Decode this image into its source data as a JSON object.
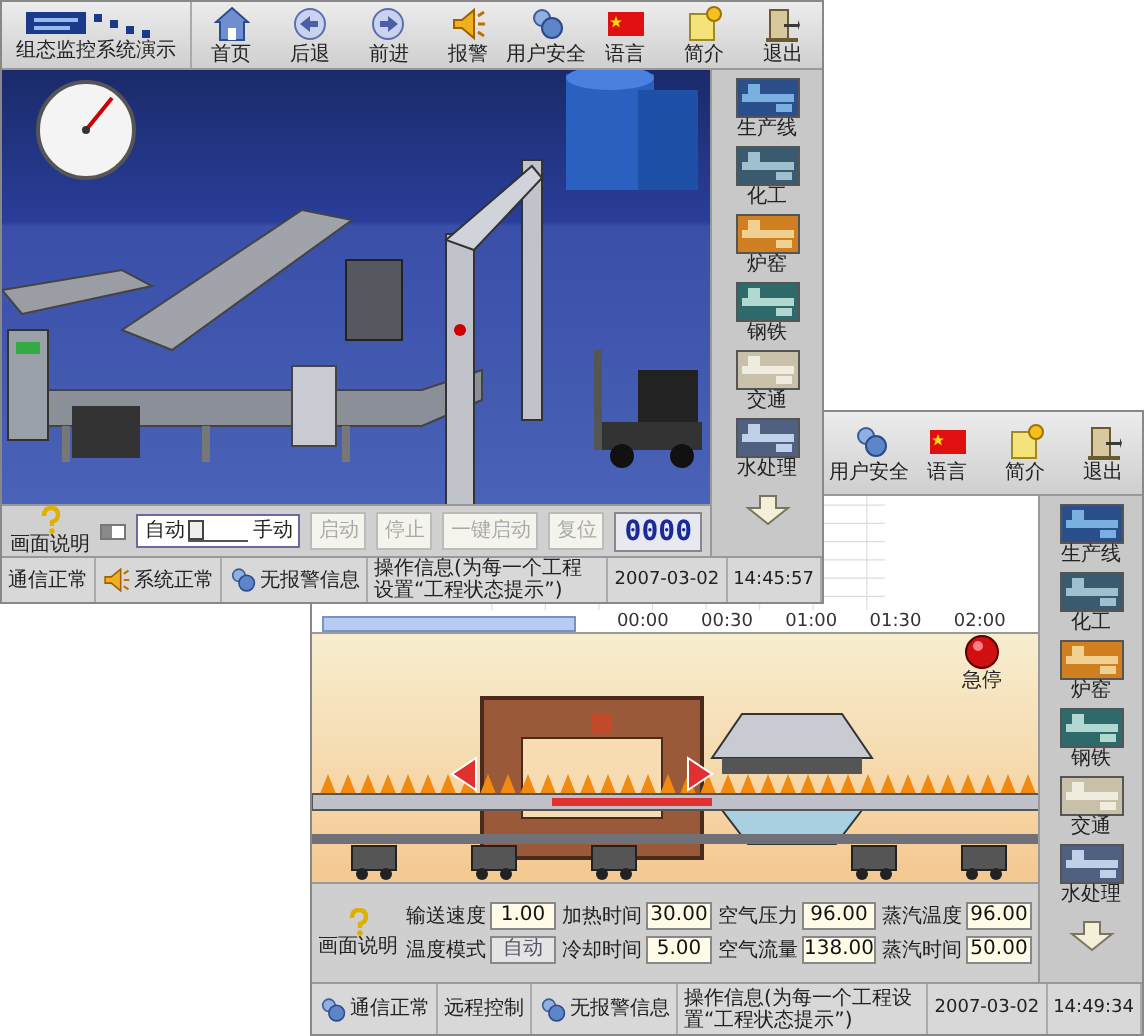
{
  "windows": [
    {
      "kind": "conveyor",
      "toolbar": {
        "title": "组态监控系统演示",
        "items": [
          {
            "kind": "home",
            "label": "首页"
          },
          {
            "kind": "back",
            "label": "后退"
          },
          {
            "kind": "forward",
            "label": "前进"
          },
          {
            "kind": "alarm",
            "label": "报警"
          },
          {
            "kind": "users",
            "label": "用户安全"
          },
          {
            "kind": "language",
            "label": "语言"
          },
          {
            "kind": "about",
            "label": "简介"
          },
          {
            "kind": "exit",
            "label": "退出"
          }
        ]
      },
      "sidebar": [
        {
          "kind": "production",
          "label": "生产线"
        },
        {
          "kind": "chemical",
          "label": "化工"
        },
        {
          "kind": "furnace",
          "label": "炉窑"
        },
        {
          "kind": "steel",
          "label": "钢铁"
        },
        {
          "kind": "traffic",
          "label": "交通"
        },
        {
          "kind": "water",
          "label": "水处理"
        }
      ],
      "controls": {
        "help_label": "画面说明",
        "slider": {
          "level": 0.4
        },
        "switch": {
          "left_label": "自动",
          "right_label": "手动",
          "on_left": true
        },
        "buttons": [
          {
            "label": "启动",
            "disabled": true
          },
          {
            "label": "停止",
            "disabled": true
          },
          {
            "label": "一键启动",
            "disabled": true
          },
          {
            "label": "复位",
            "disabled": true
          }
        ],
        "counter": "0000"
      },
      "status": [
        {
          "kind": "plain",
          "text": "通信正常"
        },
        {
          "kind": "alarm",
          "text": "系统正常"
        },
        {
          "kind": "users",
          "text": "无报警信息"
        },
        {
          "kind": "message",
          "text": "操作信息(为每一个工程设置“工程状态提示”)"
        },
        {
          "kind": "date",
          "text": "2007-03-02"
        },
        {
          "kind": "time",
          "text": "14:45:57"
        }
      ]
    },
    {
      "kind": "furnace",
      "toolbar": {
        "items": [
          {
            "kind": "users",
            "label": "用户安全"
          },
          {
            "kind": "language",
            "label": "语言"
          },
          {
            "kind": "about",
            "label": "简介"
          },
          {
            "kind": "exit",
            "label": "退出"
          }
        ]
      },
      "chart": {
        "ticks": [
          "00:00",
          "00:30",
          "01:00",
          "01:30",
          "02:00"
        ]
      },
      "sidebar": [
        {
          "kind": "production",
          "label": "生产线"
        },
        {
          "kind": "chemical",
          "label": "化工"
        },
        {
          "kind": "furnace",
          "label": "炉窑"
        },
        {
          "kind": "steel",
          "label": "钢铁"
        },
        {
          "kind": "traffic",
          "label": "交通"
        },
        {
          "kind": "water",
          "label": "水处理"
        }
      ],
      "emergency_stop": {
        "label": "急停"
      },
      "params": {
        "help_label": "画面说明",
        "fields": [
          {
            "label": "输送速度",
            "value": "1.00",
            "disabled": false
          },
          {
            "label": "加热时间",
            "value": "30.00",
            "disabled": false
          },
          {
            "label": "空气压力",
            "value": "96.00",
            "disabled": false
          },
          {
            "label": "蒸汽温度",
            "value": "96.00",
            "disabled": false
          },
          {
            "label": "温度模式",
            "value": "自动",
            "disabled": true
          },
          {
            "label": "冷却时间",
            "value": "5.00",
            "disabled": false
          },
          {
            "label": "空气流量",
            "value": "138.00",
            "disabled": false
          },
          {
            "label": "蒸汽时间",
            "value": "50.00",
            "disabled": false
          }
        ]
      },
      "status": [
        {
          "kind": "users",
          "text": "通信正常"
        },
        {
          "kind": "plain",
          "text": "远程控制"
        },
        {
          "kind": "users",
          "text": "无报警信息"
        },
        {
          "kind": "message",
          "text": "操作信息(为每一个工程设置“工程状态提示”)"
        },
        {
          "kind": "date",
          "text": "2007-03-02"
        },
        {
          "kind": "time",
          "text": "14:49:34"
        }
      ]
    }
  ]
}
